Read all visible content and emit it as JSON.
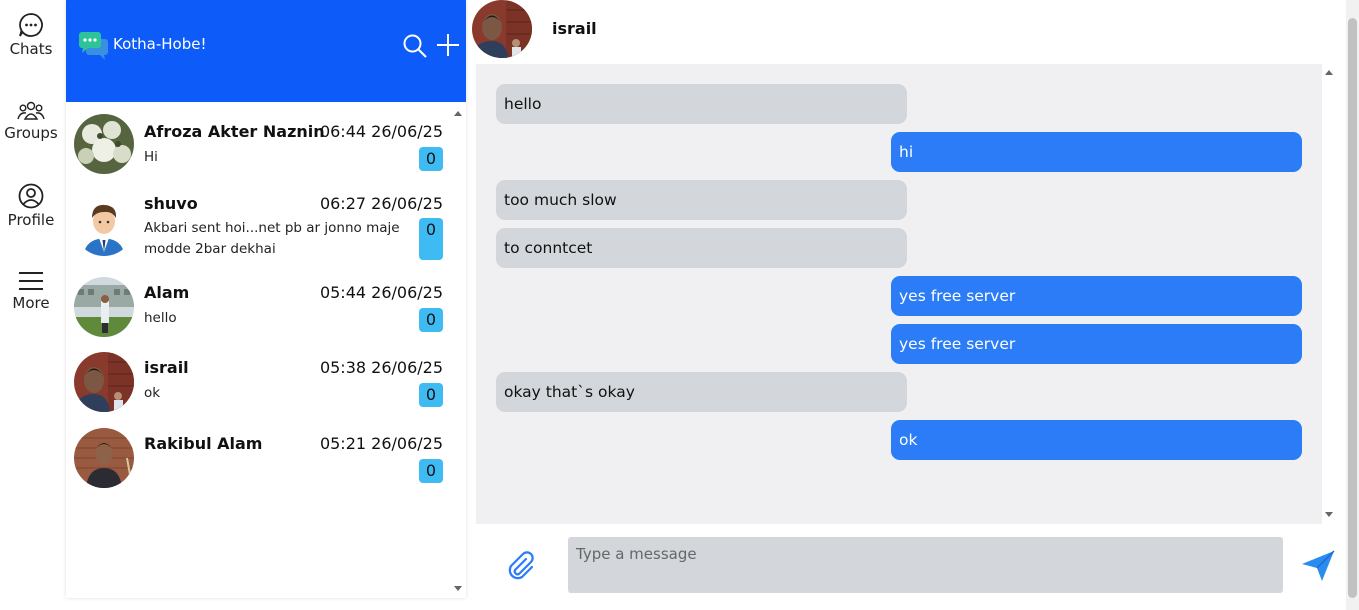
{
  "rail": {
    "items": [
      {
        "label": "Chats",
        "icon": "chat-bubble-icon"
      },
      {
        "label": "Groups",
        "icon": "groups-icon"
      },
      {
        "label": "Profile",
        "icon": "profile-icon"
      },
      {
        "label": "More",
        "icon": "hamburger-menu-icon"
      }
    ]
  },
  "app": {
    "title": "Kotha-Hobe!",
    "header_color": "#0d5cfa",
    "accent_badge_color": "#3ebbf3"
  },
  "chats": [
    {
      "name": "Afroza Akter Naznin",
      "time": "06:44 26/06/25",
      "last_message": "Hi",
      "unread": "0"
    },
    {
      "name": "shuvo",
      "time": "06:27 26/06/25",
      "last_message": "Akbari sent hoi...net pb ar jonno maje modde 2bar dekhai",
      "unread": "0"
    },
    {
      "name": "Alam",
      "time": "05:44 26/06/25",
      "last_message": "hello",
      "unread": "0"
    },
    {
      "name": "israil",
      "time": "05:38 26/06/25",
      "last_message": "ok",
      "unread": "0"
    },
    {
      "name": "Rakibul Alam",
      "time": "05:21 26/06/25",
      "last_message": "",
      "unread": "0"
    }
  ],
  "conversation": {
    "contact_name": "israil",
    "messages": [
      {
        "direction": "in",
        "text": "hello"
      },
      {
        "direction": "out",
        "text": "hi"
      },
      {
        "direction": "in",
        "text": "too much slow"
      },
      {
        "direction": "in",
        "text": "to conntcet"
      },
      {
        "direction": "out",
        "text": "yes free server"
      },
      {
        "direction": "out",
        "text": "yes free server"
      },
      {
        "direction": "in",
        "text": "okay that`s okay"
      },
      {
        "direction": "out",
        "text": "ok"
      }
    ],
    "incoming_color": "#d3d6db",
    "outgoing_color": "#2b7cf6"
  },
  "composer": {
    "placeholder": "Type a message",
    "value": ""
  }
}
